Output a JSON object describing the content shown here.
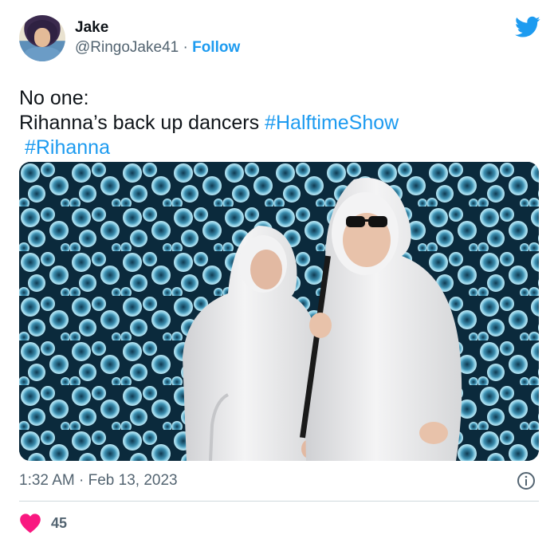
{
  "author": {
    "display_name": "Jake",
    "handle": "@RingoJake41",
    "separator": "·",
    "follow_label": "Follow"
  },
  "tweet": {
    "line1": "No one:",
    "line2_text": "Rihanna’s back up dancers",
    "hashtags": [
      "#HalftimeShow",
      "#Rihanna"
    ],
    "time": "1:32 AM",
    "date_separator": "·",
    "date": "Feb 13, 2023"
  },
  "engagement": {
    "likes": "45"
  },
  "colors": {
    "accent": "#1d9bf0",
    "heart": "#f91880",
    "text": "#0f1419",
    "muted": "#536471"
  },
  "icons": {
    "brand": "twitter-bird-icon",
    "info": "info-icon",
    "like": "heart-icon"
  }
}
